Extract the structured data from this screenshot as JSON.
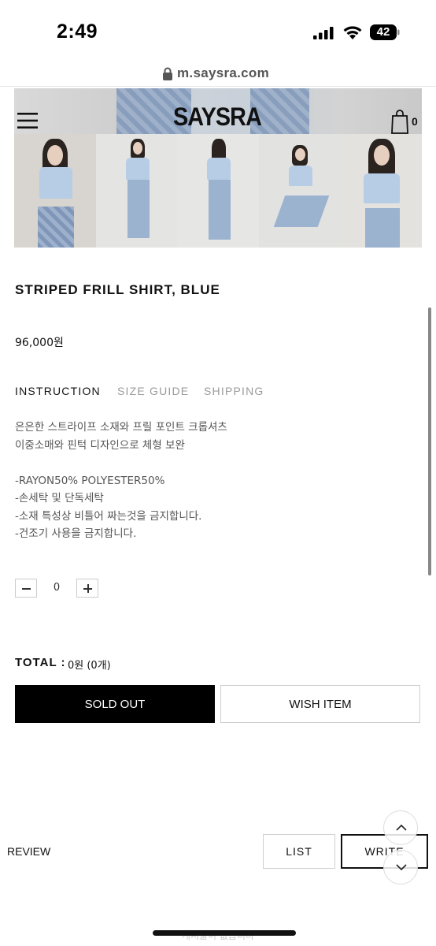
{
  "status_bar": {
    "time": "2:49",
    "battery": "42"
  },
  "browser": {
    "url": "m.saysra.com"
  },
  "header": {
    "brand": "SAYSRA",
    "cart_count": "0"
  },
  "product": {
    "title": "STRIPED FRILL SHIRT, BLUE",
    "price": "96,000원"
  },
  "tabs": [
    {
      "label": "INSTRUCTION",
      "active": true
    },
    {
      "label": "SIZE GUIDE",
      "active": false
    },
    {
      "label": "SHIPPING",
      "active": false
    }
  ],
  "description": {
    "line1": "은은한 스트라이프 소재와 프릴 포인트 크롭셔츠",
    "line2": "이중소매와 핀턱 디자인으로 체형 보완",
    "line3": "",
    "line4": "-RAYON50% POLYESTER50%",
    "line5": "-손세탁 및 단독세탁",
    "line6": "-소재 특성상 비틀어 짜는것을 금지합니다.",
    "line7": "-건조기 사용을 금지합니다."
  },
  "quantity": {
    "value": "0"
  },
  "total": {
    "label": "TOTAL :",
    "value": "0원 (0개)"
  },
  "buttons": {
    "sold_out": "SOLD OUT",
    "wish_item": "WISH ITEM",
    "list": "LIST",
    "write": "WRITE"
  },
  "review": {
    "label": "REVIEW",
    "empty_text": "게시물이 없습니다"
  },
  "colors": {
    "primary": "#000000",
    "tab_inactive": "#9a9a9a",
    "text_muted": "#555555"
  }
}
